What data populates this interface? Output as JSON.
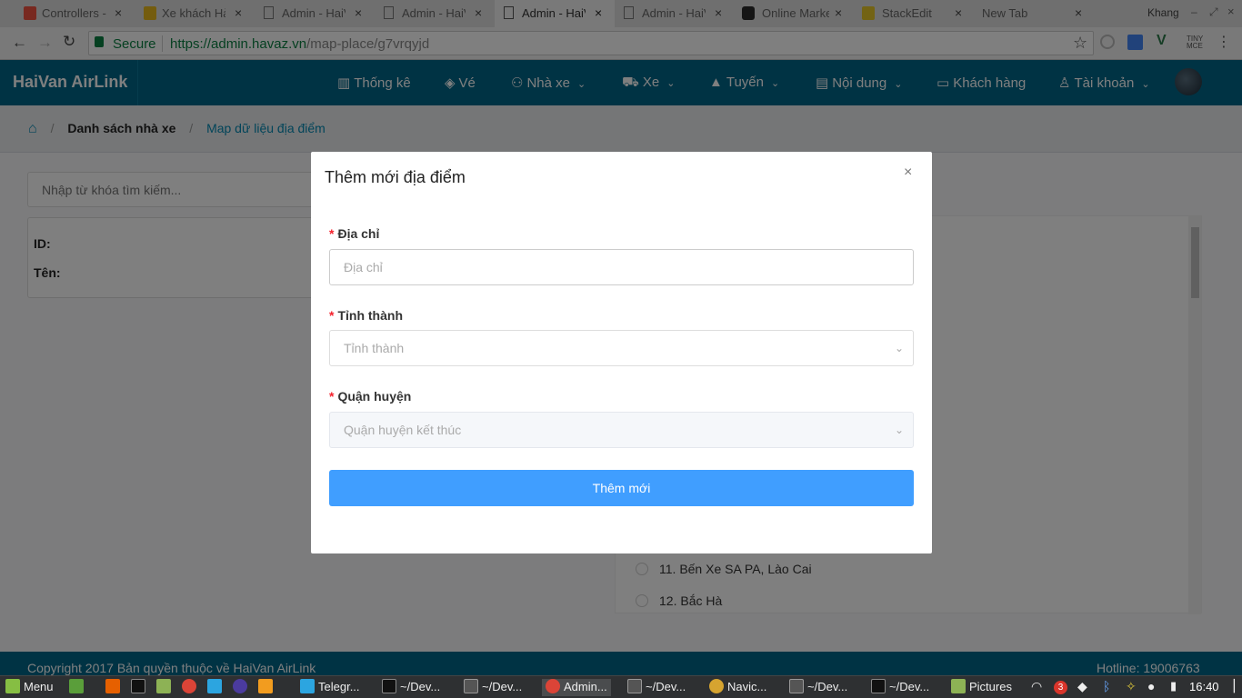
{
  "browser": {
    "tabs": [
      {
        "label": "Controllers -",
        "icon": "laravel-icon",
        "color": "#f05340"
      },
      {
        "label": "Xe khách Hà",
        "icon": "haivan-favicon",
        "color": "#e8b91c"
      },
      {
        "label": "Admin - HaiV",
        "icon": "page-icon",
        "color": "#777777"
      },
      {
        "label": "Admin - HaiV",
        "icon": "page-icon",
        "color": "#777777"
      },
      {
        "label": "Admin - HaiV",
        "icon": "page-icon",
        "color": "#777777"
      },
      {
        "label": "Admin - HaiV",
        "icon": "page-icon",
        "color": "#777777"
      },
      {
        "label": "Online Marke",
        "icon": "dillinger-icon",
        "color": "#2b2b2b"
      },
      {
        "label": "StackEdit",
        "icon": "stackedit-icon",
        "color": "#e6c729"
      },
      {
        "label": "New Tab",
        "icon": "none",
        "color": "#777777"
      }
    ],
    "active_tab": 4,
    "close_glyph": "×",
    "profile": "Khang",
    "secure_label": "Secure",
    "url_host": "https://admin.havaz.vn",
    "url_path": "/map-place/g7vrqyjd"
  },
  "app": {
    "brand": "HaiVan AirLink",
    "nav": [
      {
        "label": "Thống kê",
        "icon": "bar-chart-icon",
        "dropdown": false
      },
      {
        "label": "Vé",
        "icon": "ticket-icon",
        "dropdown": false
      },
      {
        "label": "Nhà xe",
        "icon": "users-icon",
        "dropdown": true
      },
      {
        "label": "Xe",
        "icon": "car-icon",
        "dropdown": true
      },
      {
        "label": "Tuyến",
        "icon": "road-icon",
        "dropdown": true
      },
      {
        "label": "Nội dung",
        "icon": "book-icon",
        "dropdown": true
      },
      {
        "label": "Khách hàng",
        "icon": "id-card-icon",
        "dropdown": false
      },
      {
        "label": "Tài khoản",
        "icon": "user-icon",
        "dropdown": true
      }
    ],
    "breadcrumb": {
      "level1": "Danh sách nhà xe",
      "level2": "Map dữ liệu địa điểm",
      "separator": "/"
    },
    "search_placeholder": "Nhập từ khóa tìm kiếm...",
    "info": {
      "id_label": "ID:",
      "name_label": "Tên:"
    },
    "list_items": [
      "11. Bến Xe SA PA, Lào Cai",
      "12. Bắc Hà"
    ],
    "footer": {
      "copyright": "Copyright 2017 Bản quyền thuộc về HaiVan AirLink",
      "hotline": "Hotline: 19006763"
    },
    "colors": {
      "header": "#006789",
      "primary_button": "#409eff",
      "required": "#f5222d"
    }
  },
  "modal": {
    "title": "Thêm mới địa điểm",
    "close": "×",
    "required_mark": "*",
    "address_label": "Địa chỉ",
    "address_placeholder": "Địa chỉ",
    "address_value": "",
    "province_label": "Tỉnh thành",
    "province_placeholder": "Tỉnh thành",
    "district_label": "Quận huyện",
    "district_placeholder": "Quận huyện kết thúc",
    "submit_label": "Thêm mới"
  },
  "taskbar": {
    "menu_label": "Menu",
    "windows": [
      "Telegr...",
      "~/Dev...",
      "~/Dev...",
      "Admin...",
      "~/Dev...",
      "Navic...",
      "~/Dev...",
      "~/Dev...",
      "Pictures"
    ],
    "notification_count": "3",
    "clock": "16:40"
  }
}
